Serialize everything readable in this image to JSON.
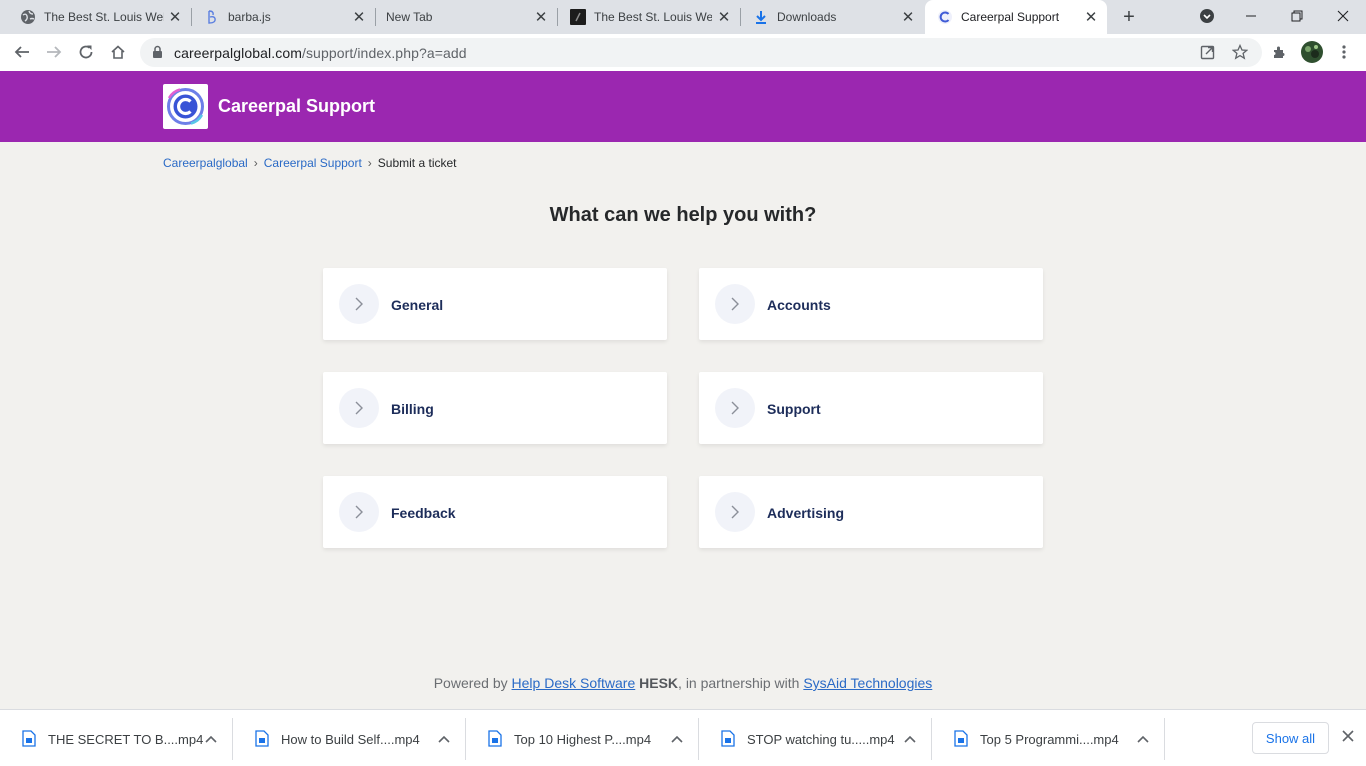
{
  "browser": {
    "tabs": [
      {
        "title": "The Best St. Louis Web",
        "icon": "globe-icon"
      },
      {
        "title": "barba.js",
        "icon": "barba-logo-icon"
      },
      {
        "title": "New Tab",
        "icon": ""
      },
      {
        "title": "The Best St. Louis Web",
        "icon": "site-favicon-dark"
      },
      {
        "title": "Downloads",
        "icon": "download-icon"
      },
      {
        "title": "Careerpal Support",
        "icon": "careerpal-favicon"
      }
    ],
    "active_tab_index": 5,
    "url_host": "careerpalglobal.com",
    "url_path": "/support/index.php?a=add"
  },
  "header": {
    "brand": "Careerpal Support",
    "color": "#9b27b0"
  },
  "breadcrumb": {
    "items": [
      "Careerpalglobal",
      "Careerpal Support"
    ],
    "current": "Submit a ticket"
  },
  "main": {
    "title": "What can we help you with?",
    "categories": [
      "General",
      "Accounts",
      "Billing",
      "Support",
      "Feedback",
      "Advertising"
    ]
  },
  "footer": {
    "prefix": "Powered by",
    "link1": "Help Desk Software",
    "brand": "HESK",
    "middle": ", in partnership with",
    "link2": "SysAid Technologies"
  },
  "downloads": {
    "items": [
      "THE SECRET TO B....mp4",
      "How to Build Self....mp4",
      "Top 10 Highest P....mp4",
      "STOP watching tu.....mp4",
      "Top 5 Programmi....mp4"
    ],
    "show_all": "Show all"
  }
}
